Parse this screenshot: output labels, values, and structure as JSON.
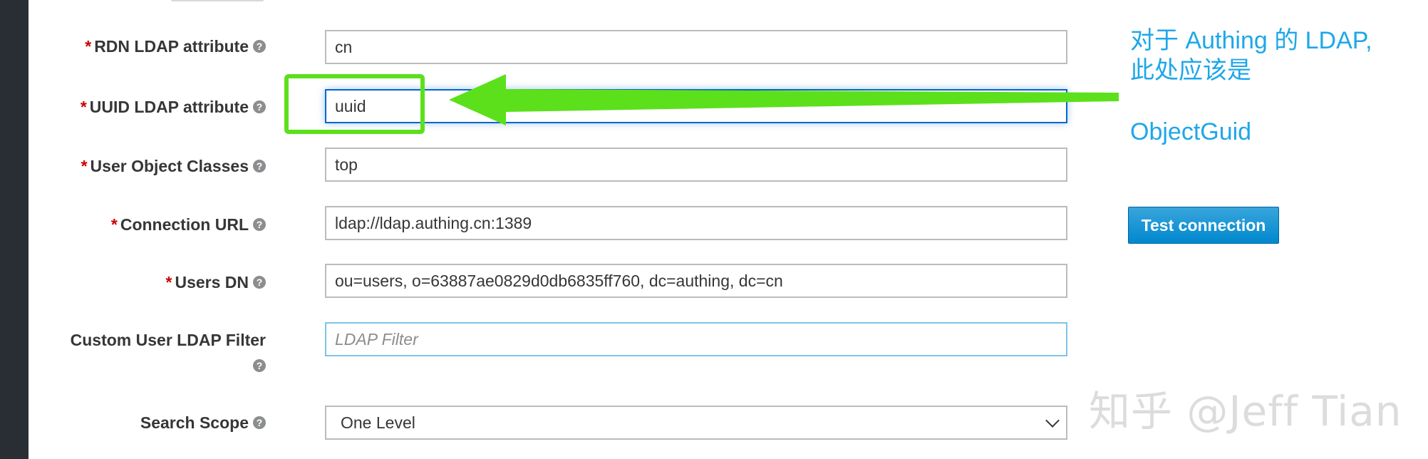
{
  "form": {
    "rows": [
      {
        "label": "RDN LDAP attribute",
        "required": true,
        "value": "cn"
      },
      {
        "label": "UUID LDAP attribute",
        "required": true,
        "value": "uuid"
      },
      {
        "label": "User Object Classes",
        "required": true,
        "value": "top"
      },
      {
        "label": "Connection URL",
        "required": true,
        "value": "ldap://ldap.authing.cn:1389"
      },
      {
        "label": "Users DN",
        "required": true,
        "value": "ou=users, o=63887ae0829d0db6835ff760, dc=authing, dc=cn"
      },
      {
        "label": "Custom User LDAP Filter",
        "required": false,
        "placeholder": "LDAP Filter"
      },
      {
        "label": "Search Scope",
        "required": false,
        "value": "One Level"
      }
    ],
    "required_marker": "*",
    "help_icon": "?",
    "test_connection_label": "Test connection"
  },
  "annotation": {
    "line1": "对于 Authing 的 LDAP,",
    "line2": "此处应该是",
    "line3": "ObjectGuid",
    "color": "#1ea7e8",
    "highlight_color": "#5ce01b"
  },
  "watermark": "知乎 @Jeff Tian"
}
